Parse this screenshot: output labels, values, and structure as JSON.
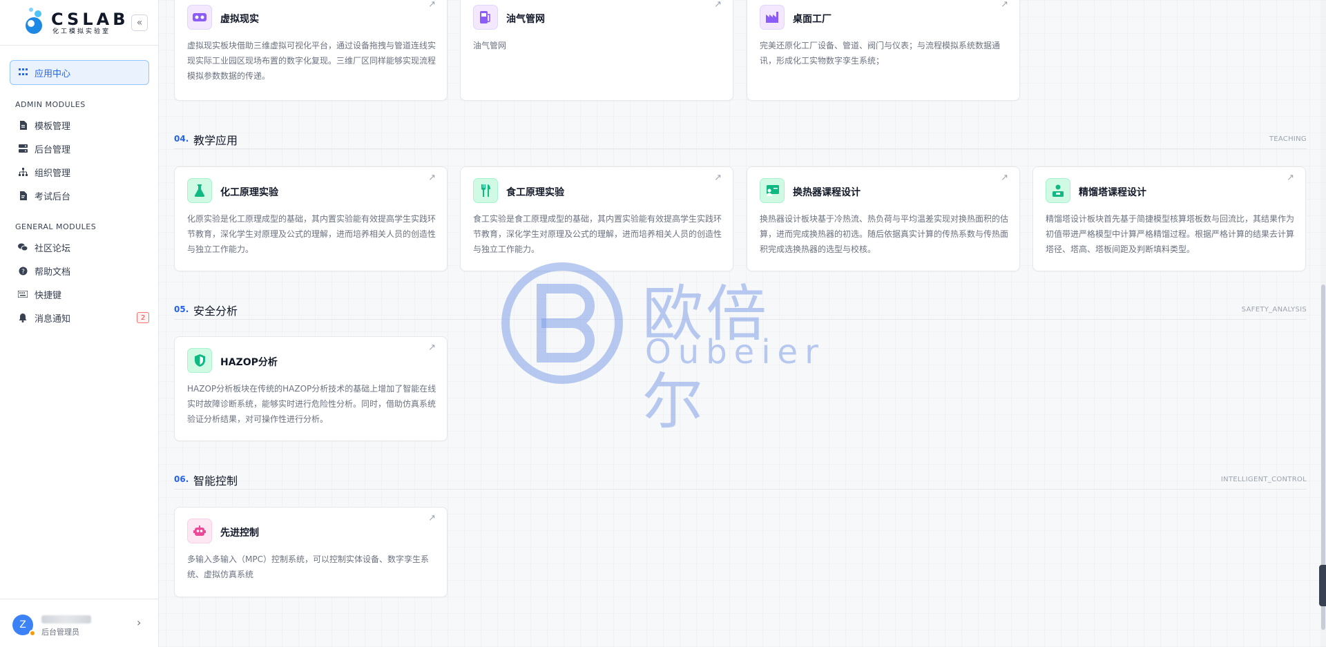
{
  "sidebar": {
    "logo_title": "CSLAB",
    "logo_sub": "化工模拟实验室",
    "collapse_glyph": "«",
    "active_item": "应用中心",
    "admin_section": "ADMIN MODULES",
    "admin_items": [
      "模板管理",
      "后台管理",
      "组织管理",
      "考试后台"
    ],
    "general_section": "GENERAL MODULES",
    "general_items": [
      "社区论坛",
      "帮助文档",
      "快捷键",
      "消息通知"
    ],
    "notify_count": "2",
    "user_initial": "Z",
    "user_role": "后台管理员"
  },
  "sections": [
    {
      "num": "04.",
      "title": "教学应用",
      "code": "TEACHING"
    },
    {
      "num": "05.",
      "title": "安全分析",
      "code": "SAFETY_ANALYSIS"
    },
    {
      "num": "06.",
      "title": "智能控制",
      "code": "INTELLIGENT_CONTROL"
    }
  ],
  "cards": {
    "vr": {
      "title": "虚拟现实",
      "desc": "虚拟现实板块借助三维虚拟可视化平台，通过设备拖拽与管道连线实现实际工业园区现场布置的数字化复现。三维厂区同样能够实现流程模拟参数数据的传递。",
      "icon": "vr-headset-icon",
      "color": "#8b5cf6"
    },
    "oilgas": {
      "title": "油气管网",
      "desc": "油气管网",
      "icon": "fuel-pump-icon",
      "color": "#8b5cf6"
    },
    "desktop": {
      "title": "桌面工厂",
      "desc": "完美还原化工厂设备、管道、阀门与仪表；与流程模拟系统数据通讯，形成化工实物数字孪生系统；",
      "icon": "factory-icon",
      "color": "#8b5cf6"
    },
    "chem": {
      "title": "化工原理实验",
      "desc": "化原实验是化工原理成型的基础，其内置实验能有效提高学生实践环节教育，深化学生对原理及公式的理解，进而培养相关人员的创造性与独立工作能力。",
      "icon": "flask-icon",
      "color": "#10b981"
    },
    "food": {
      "title": "食工原理实验",
      "desc": "食工实验是食工原理成型的基础，其内置实验能有效提高学生实践环节教育，深化学生对原理及公式的理解，进而培养相关人员的创造性与独立工作能力。",
      "icon": "utensils-icon",
      "color": "#10b981"
    },
    "heat": {
      "title": "换热器课程设计",
      "desc": "换热器设计板块基于冷热流、热负荷与平均温差实现对换热面积的估算，进而完成换热器的初选。随后依据真实计算的传热系数与传热面积完成选换热器的选型与校核。",
      "icon": "teacher-board-icon",
      "color": "#10b981"
    },
    "dist": {
      "title": "精馏塔课程设计",
      "desc": "精馏塔设计板块首先基于简捷模型核算塔板数与回流比，其结果作为初值带进严格模型中计算严格精馏过程。根据严格计算的结果去计算塔径、塔高、塔板间距及判断填料类型。",
      "icon": "student-desk-icon",
      "color": "#10b981"
    },
    "hazop": {
      "title": "HAZOP分析",
      "desc": "HAZOP分析板块在传统的HAZOP分析技术的基础上增加了智能在线实时故障诊断系统，能够实时进行危险性分析。同时，借助仿真系统验证分析结果，对可操作性进行分析。",
      "icon": "shield-icon",
      "color": "#10b981"
    },
    "mpc": {
      "title": "先进控制",
      "desc": "多输入多输入（MPC）控制系统，可以控制实体设备、数字孪生系统、虚拟仿真系统",
      "icon": "robot-icon",
      "color": "#ec4899"
    }
  },
  "card_arrow": "↗",
  "watermark": {
    "cn": "欧倍尔",
    "en": "Oubeier"
  }
}
